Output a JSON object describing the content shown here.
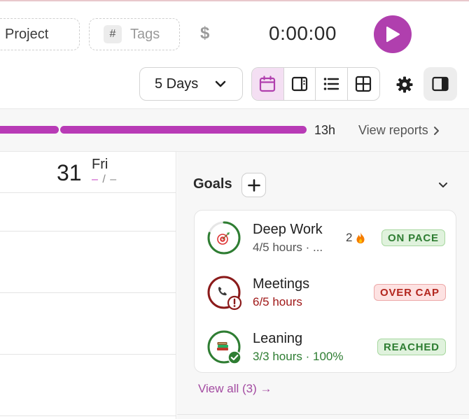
{
  "toolbar": {
    "project_label": "Project",
    "tags_hash": "#",
    "tags_label": "Tags",
    "billable_symbol": "$",
    "timer_value": "0:00:00",
    "play_icon": "play-icon"
  },
  "view_controls": {
    "range_select": "5 Days",
    "view_icons": [
      "calendar-icon",
      "split-view-icon",
      "list-icon",
      "grid-icon"
    ],
    "active_view": "calendar-icon",
    "settings_icon": "gear-icon",
    "panel_icon": "side-panel-icon"
  },
  "summary": {
    "total": "13h",
    "reports_link": "View reports",
    "progress_color": "#b83bb6"
  },
  "calendar": {
    "day_number": "31",
    "day_name": "Fri",
    "day_dash_left": "–",
    "day_dash_sep": " / ",
    "day_dash_right": "–"
  },
  "goals": {
    "title": "Goals",
    "add_label": "+",
    "view_all": "View all (3) →",
    "items": [
      {
        "name": "Deep Work",
        "sub": "4/5 hours · ...",
        "streak": "2",
        "streak_icon": "fire-icon",
        "badge": "ON PACE",
        "progress": 0.8,
        "icon": "target-icon",
        "color": "#2e7d32"
      },
      {
        "name": "Meetings",
        "sub": "6/5 hours",
        "badge": "OVER CAP",
        "progress": 1.0,
        "icon": "phone-icon",
        "color": "#8b1a1a"
      },
      {
        "name": "Leaning",
        "sub": "3/3 hours · 100%",
        "badge": "REACHED",
        "progress": 1.0,
        "icon": "books-icon",
        "color": "#2e7d32"
      }
    ]
  }
}
